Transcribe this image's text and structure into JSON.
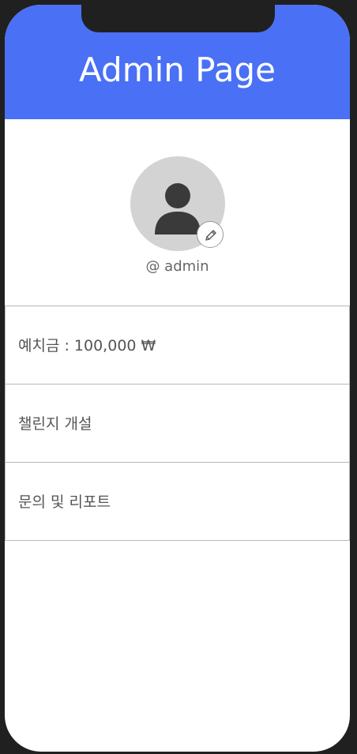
{
  "header": {
    "title": "Admin Page"
  },
  "profile": {
    "avatar_icon": "person-icon",
    "edit_icon": "pencil-icon",
    "username": "@ admin"
  },
  "menu": {
    "items": [
      {
        "label": "예치금 : 100,000 ₩"
      },
      {
        "label": "챌린지 개설"
      },
      {
        "label": "문의 및 리포트"
      }
    ]
  },
  "colors": {
    "header_bg": "#4a70f5",
    "avatar_bg": "#d3d3d3",
    "avatar_fg": "#3a3a3a"
  }
}
